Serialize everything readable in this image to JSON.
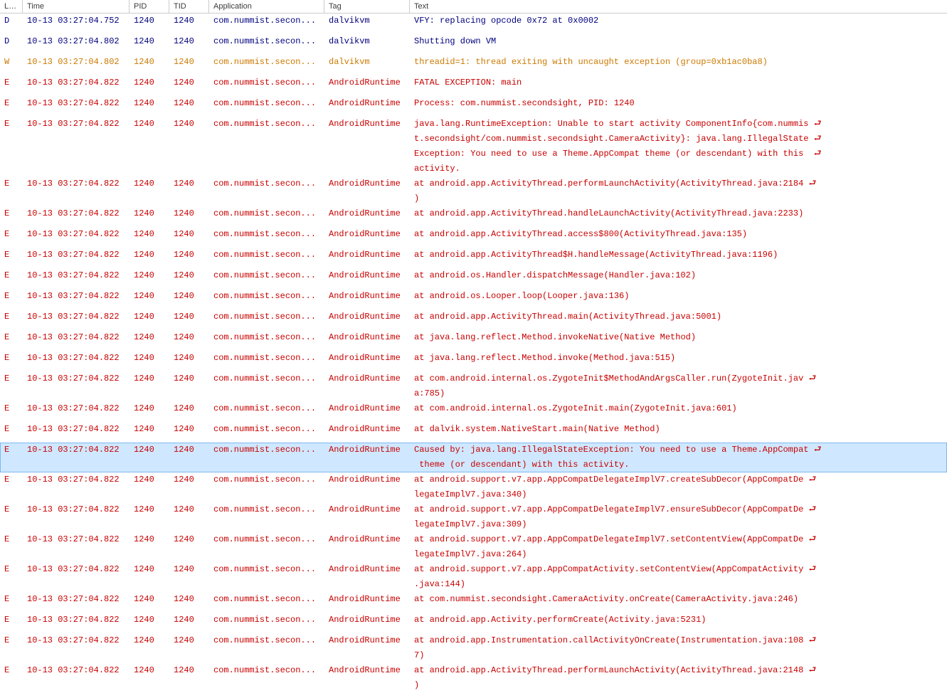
{
  "columns": {
    "level": "L…",
    "time": "Time",
    "pid": "PID",
    "tid": "TID",
    "application": "Application",
    "tag": "Tag",
    "text": "Text"
  },
  "colors": {
    "D": "#00007f",
    "W": "#cc7a00",
    "E": "#c80000",
    "selected_bg": "#cfe8ff",
    "selected_border": "#7fb8ef"
  },
  "app_display": "com.nummist.secon...",
  "selected_index": 18,
  "rows": [
    {
      "level": "D",
      "time": "10-13 03:27:04.752",
      "pid": "1240",
      "tid": "1240",
      "tag": "dalvikvm",
      "text": "VFY: replacing opcode 0x72 at 0x0002"
    },
    {
      "level": "D",
      "time": "10-13 03:27:04.802",
      "pid": "1240",
      "tid": "1240",
      "tag": "dalvikvm",
      "text": "Shutting down VM"
    },
    {
      "level": "W",
      "time": "10-13 03:27:04.802",
      "pid": "1240",
      "tid": "1240",
      "tag": "dalvikvm",
      "text": "threadid=1: thread exiting with uncaught exception (group=0xb1ac0ba8)"
    },
    {
      "level": "E",
      "time": "10-13 03:27:04.822",
      "pid": "1240",
      "tid": "1240",
      "tag": "AndroidRuntime",
      "text": "FATAL EXCEPTION: main"
    },
    {
      "level": "E",
      "time": "10-13 03:27:04.822",
      "pid": "1240",
      "tid": "1240",
      "tag": "AndroidRuntime",
      "text": "Process: com.nummist.secondsight, PID: 1240"
    },
    {
      "level": "E",
      "time": "10-13 03:27:04.822",
      "pid": "1240",
      "tid": "1240",
      "tag": "AndroidRuntime",
      "text": "java.lang.RuntimeException: Unable to start activity ComponentInfo{com.nummis ⮐\nt.secondsight/com.nummist.secondsight.CameraActivity}: java.lang.IllegalState ⮐\nException: You need to use a Theme.AppCompat theme (or descendant) with this  ⮐\nactivity."
    },
    {
      "level": "E",
      "time": "10-13 03:27:04.822",
      "pid": "1240",
      "tid": "1240",
      "tag": "AndroidRuntime",
      "text": "at android.app.ActivityThread.performLaunchActivity(ActivityThread.java:2184 ⮐\n)"
    },
    {
      "level": "E",
      "time": "10-13 03:27:04.822",
      "pid": "1240",
      "tid": "1240",
      "tag": "AndroidRuntime",
      "text": "at android.app.ActivityThread.handleLaunchActivity(ActivityThread.java:2233)"
    },
    {
      "level": "E",
      "time": "10-13 03:27:04.822",
      "pid": "1240",
      "tid": "1240",
      "tag": "AndroidRuntime",
      "text": "at android.app.ActivityThread.access$800(ActivityThread.java:135)"
    },
    {
      "level": "E",
      "time": "10-13 03:27:04.822",
      "pid": "1240",
      "tid": "1240",
      "tag": "AndroidRuntime",
      "text": "at android.app.ActivityThread$H.handleMessage(ActivityThread.java:1196)"
    },
    {
      "level": "E",
      "time": "10-13 03:27:04.822",
      "pid": "1240",
      "tid": "1240",
      "tag": "AndroidRuntime",
      "text": "at android.os.Handler.dispatchMessage(Handler.java:102)"
    },
    {
      "level": "E",
      "time": "10-13 03:27:04.822",
      "pid": "1240",
      "tid": "1240",
      "tag": "AndroidRuntime",
      "text": "at android.os.Looper.loop(Looper.java:136)"
    },
    {
      "level": "E",
      "time": "10-13 03:27:04.822",
      "pid": "1240",
      "tid": "1240",
      "tag": "AndroidRuntime",
      "text": "at android.app.ActivityThread.main(ActivityThread.java:5001)"
    },
    {
      "level": "E",
      "time": "10-13 03:27:04.822",
      "pid": "1240",
      "tid": "1240",
      "tag": "AndroidRuntime",
      "text": "at java.lang.reflect.Method.invokeNative(Native Method)"
    },
    {
      "level": "E",
      "time": "10-13 03:27:04.822",
      "pid": "1240",
      "tid": "1240",
      "tag": "AndroidRuntime",
      "text": "at java.lang.reflect.Method.invoke(Method.java:515)"
    },
    {
      "level": "E",
      "time": "10-13 03:27:04.822",
      "pid": "1240",
      "tid": "1240",
      "tag": "AndroidRuntime",
      "text": "at com.android.internal.os.ZygoteInit$MethodAndArgsCaller.run(ZygoteInit.jav ⮐\na:785)"
    },
    {
      "level": "E",
      "time": "10-13 03:27:04.822",
      "pid": "1240",
      "tid": "1240",
      "tag": "AndroidRuntime",
      "text": "at com.android.internal.os.ZygoteInit.main(ZygoteInit.java:601)"
    },
    {
      "level": "E",
      "time": "10-13 03:27:04.822",
      "pid": "1240",
      "tid": "1240",
      "tag": "AndroidRuntime",
      "text": "at dalvik.system.NativeStart.main(Native Method)"
    },
    {
      "level": "E",
      "time": "10-13 03:27:04.822",
      "pid": "1240",
      "tid": "1240",
      "tag": "AndroidRuntime",
      "text": "Caused by: java.lang.IllegalStateException: You need to use a Theme.AppCompat ⮐\n theme (or descendant) with this activity."
    },
    {
      "level": "E",
      "time": "10-13 03:27:04.822",
      "pid": "1240",
      "tid": "1240",
      "tag": "AndroidRuntime",
      "text": "at android.support.v7.app.AppCompatDelegateImplV7.createSubDecor(AppCompatDe ⮐\nlegateImplV7.java:340)"
    },
    {
      "level": "E",
      "time": "10-13 03:27:04.822",
      "pid": "1240",
      "tid": "1240",
      "tag": "AndroidRuntime",
      "text": "at android.support.v7.app.AppCompatDelegateImplV7.ensureSubDecor(AppCompatDe ⮐\nlegateImplV7.java:309)"
    },
    {
      "level": "E",
      "time": "10-13 03:27:04.822",
      "pid": "1240",
      "tid": "1240",
      "tag": "AndroidRuntime",
      "text": "at android.support.v7.app.AppCompatDelegateImplV7.setContentView(AppCompatDe ⮐\nlegateImplV7.java:264)"
    },
    {
      "level": "E",
      "time": "10-13 03:27:04.822",
      "pid": "1240",
      "tid": "1240",
      "tag": "AndroidRuntime",
      "text": "at android.support.v7.app.AppCompatActivity.setContentView(AppCompatActivity ⮐\n.java:144)"
    },
    {
      "level": "E",
      "time": "10-13 03:27:04.822",
      "pid": "1240",
      "tid": "1240",
      "tag": "AndroidRuntime",
      "text": "at com.nummist.secondsight.CameraActivity.onCreate(CameraActivity.java:246)"
    },
    {
      "level": "E",
      "time": "10-13 03:27:04.822",
      "pid": "1240",
      "tid": "1240",
      "tag": "AndroidRuntime",
      "text": "at android.app.Activity.performCreate(Activity.java:5231)"
    },
    {
      "level": "E",
      "time": "10-13 03:27:04.822",
      "pid": "1240",
      "tid": "1240",
      "tag": "AndroidRuntime",
      "text": "at android.app.Instrumentation.callActivityOnCreate(Instrumentation.java:108 ⮐\n7)"
    },
    {
      "level": "E",
      "time": "10-13 03:27:04.822",
      "pid": "1240",
      "tid": "1240",
      "tag": "AndroidRuntime",
      "text": "at android.app.ActivityThread.performLaunchActivity(ActivityThread.java:2148 ⮐\n)"
    }
  ]
}
